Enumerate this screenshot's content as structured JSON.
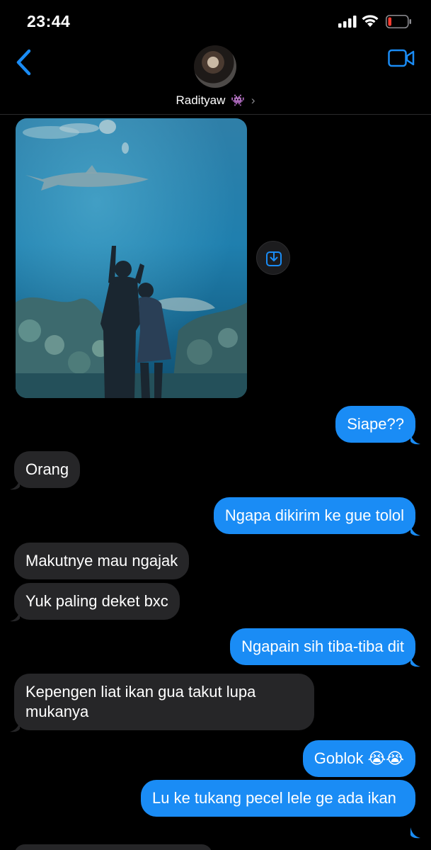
{
  "status_bar": {
    "time": "23:44",
    "battery_color": "#ff3b30"
  },
  "header": {
    "contact_name": "Radityaw",
    "contact_emoji": "👾",
    "back_icon": "chevron-left-icon",
    "video_icon": "video-camera-icon",
    "accent_color": "#1a8cf5"
  },
  "attachment": {
    "type": "photo",
    "subject": "aquarium",
    "save_icon": "save-download-icon"
  },
  "messages": [
    {
      "sender": "them",
      "text": "Orang"
    },
    {
      "sender": "me",
      "text": "Siape??"
    },
    {
      "sender": "me",
      "text": "Ngapa dikirim ke gue tolol"
    },
    {
      "sender": "them",
      "text": "Makutnye mau ngajak"
    },
    {
      "sender": "them",
      "text": "Yuk paling deket bxc"
    },
    {
      "sender": "me",
      "text": "Ngapain sih tiba-tiba dit"
    },
    {
      "sender": "them",
      "text": "Kepengen liat ikan gua takut lupa mukanya"
    },
    {
      "sender": "me",
      "text": "Goblok 😭😭"
    },
    {
      "sender": "me",
      "text": "Lu ke tukang pecel lele ge ada ikan"
    }
  ],
  "colors": {
    "incoming_bubble": "#262628",
    "outgoing_bubble": "#1a8cf5",
    "background": "#000000"
  }
}
